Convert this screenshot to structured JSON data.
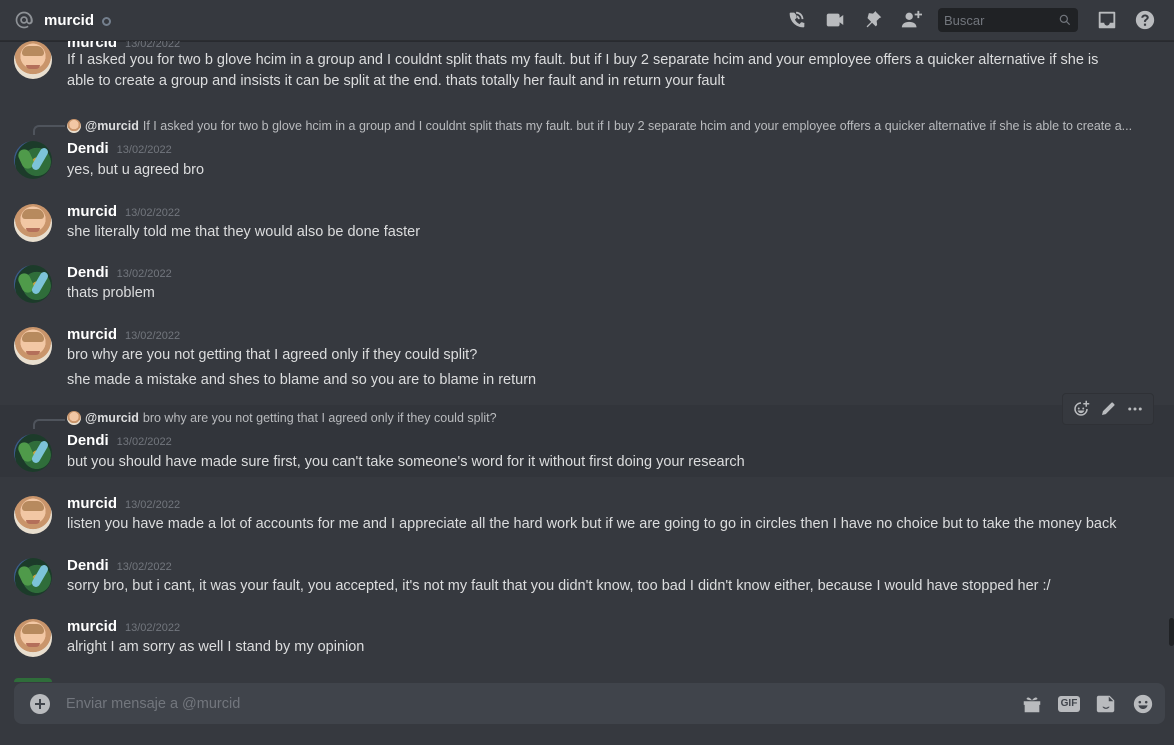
{
  "header": {
    "title": "murcid",
    "search_placeholder": "Buscar"
  },
  "messages": [
    {
      "author": "murcid",
      "timestamp": "13/02/2022",
      "avatar": "murcid",
      "lines": [
        "If I asked you for two b glove hcim in a group and I couldnt split thats my fault. but if I buy 2 separate hcim and your employee offers a quicker alternative if she is able to create a group and insists it can be split at the end. thats totally her fault and in return your fault"
      ]
    },
    {
      "author": "Dendi",
      "timestamp": "13/02/2022",
      "avatar": "dendi",
      "reply": {
        "name": "@murcid",
        "text": "If I asked you for two b glove hcim in a group and I couldnt split thats my fault. but if I buy 2 separate hcim and your employee offers a quicker alternative if she is able to create a..."
      },
      "lines": [
        "yes,  but u agreed bro"
      ]
    },
    {
      "author": "murcid",
      "timestamp": "13/02/2022",
      "avatar": "murcid",
      "lines": [
        "she literally told me that they would also be done faster"
      ]
    },
    {
      "author": "Dendi",
      "timestamp": "13/02/2022",
      "avatar": "dendi",
      "lines": [
        "thats problem"
      ]
    },
    {
      "author": "murcid",
      "timestamp": "13/02/2022",
      "avatar": "murcid",
      "lines": [
        "bro why are you not getting that I agreed only if they could split?",
        "she made a mistake and shes to blame and so you are to blame in return"
      ]
    },
    {
      "author": "Dendi",
      "timestamp": "13/02/2022",
      "avatar": "dendi",
      "reply": {
        "name": "@murcid",
        "text": "bro why are you not getting that I agreed only if they could split?"
      },
      "lines": [
        "but you should have made sure first, you can't take someone's word for it without first doing your research"
      ]
    },
    {
      "author": "murcid",
      "timestamp": "13/02/2022",
      "avatar": "murcid",
      "lines": [
        "listen you have made a lot of accounts for me and I appreciate all the hard work but if we are going to go in circles then I have no choice but to take the money back"
      ]
    },
    {
      "author": "Dendi",
      "timestamp": "13/02/2022",
      "avatar": "dendi",
      "lines": [
        "sorry bro, but i cant, it was your fault, you accepted, it's not my fault that you didn't know, too bad I didn't know either, because I would have stopped her :/"
      ]
    },
    {
      "author": "murcid",
      "timestamp": "13/02/2022",
      "avatar": "murcid",
      "lines": [
        "alright I am sorry as well I stand by my opinion"
      ]
    }
  ],
  "composer": {
    "placeholder": "Enviar mensaje a @murcid",
    "gif_label": "GIF"
  }
}
